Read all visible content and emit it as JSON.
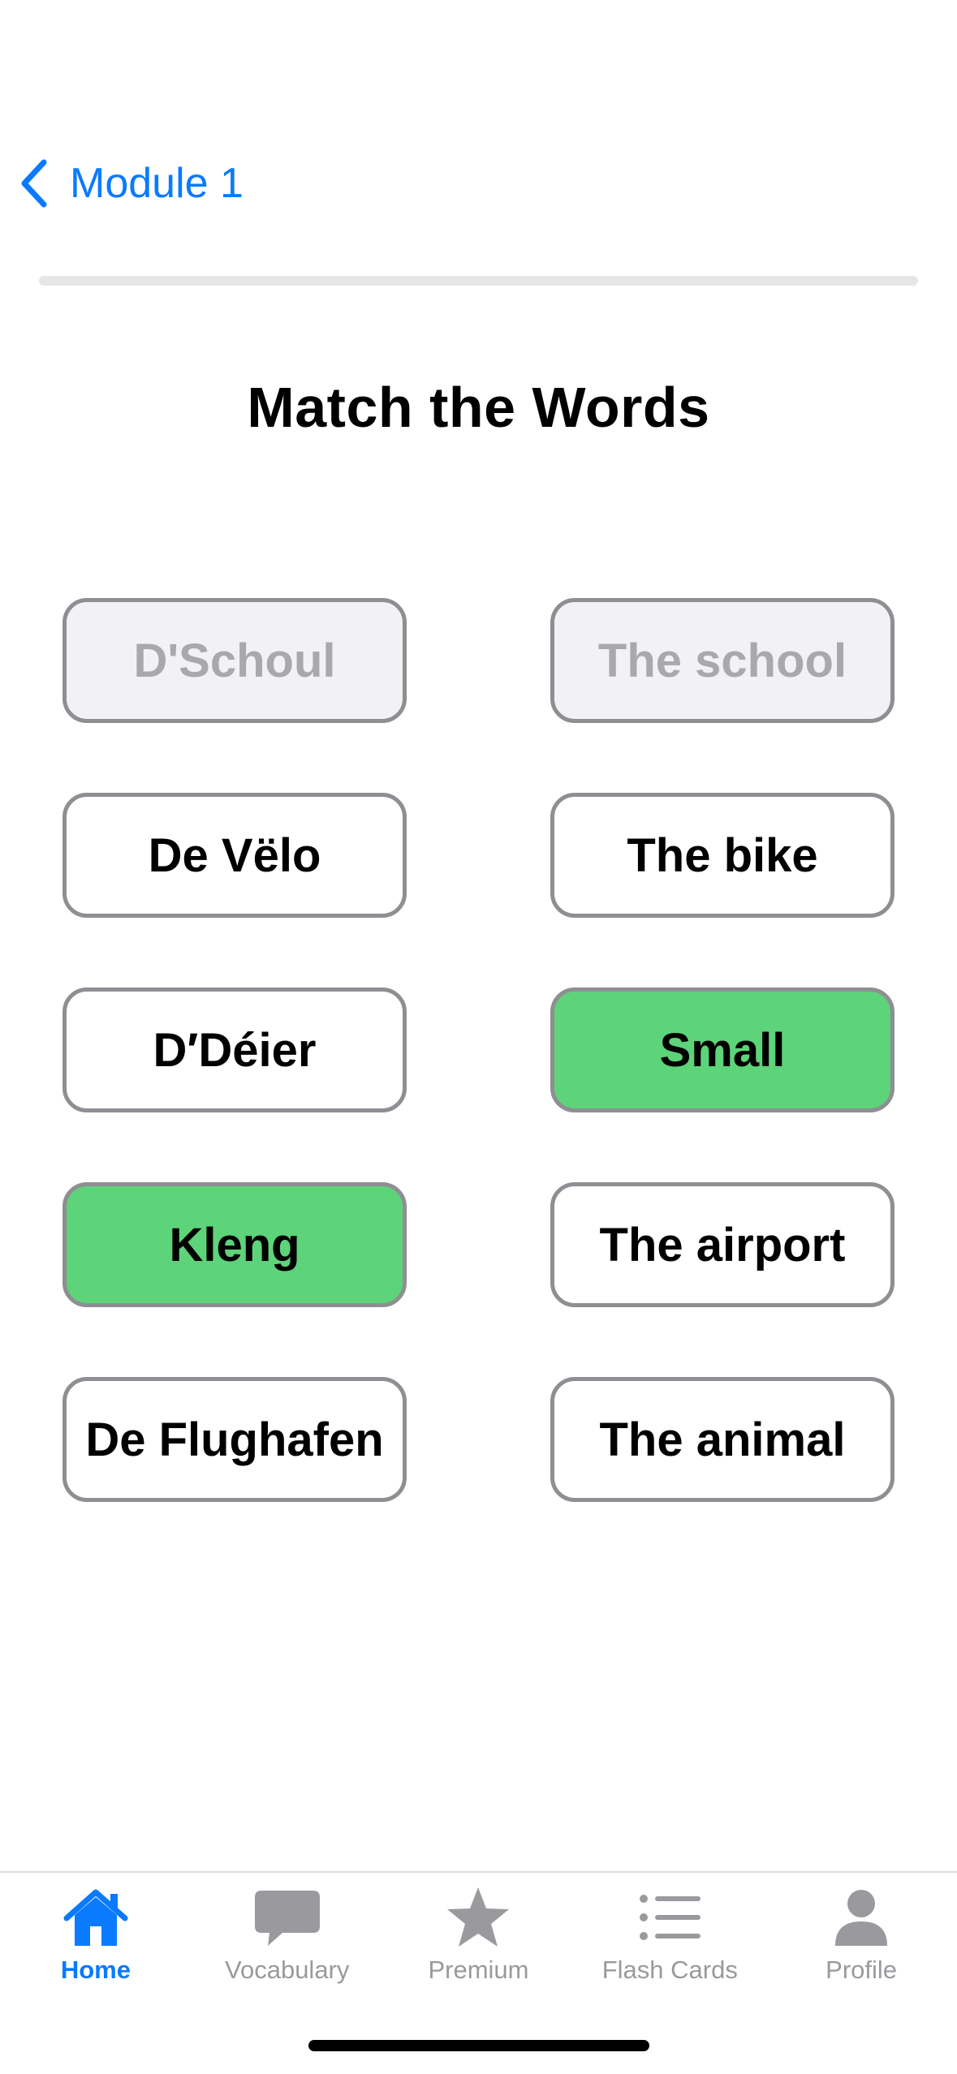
{
  "nav": {
    "back_label": "Module 1"
  },
  "progress": {
    "fraction": 0.0
  },
  "title": "Match the Words",
  "pairs_grid": {
    "left": [
      {
        "text": "D'Schoul",
        "state": "matched"
      },
      {
        "text": "De Vëlo",
        "state": "default"
      },
      {
        "text": "D′Déier",
        "state": "default"
      },
      {
        "text": "Kleng",
        "state": "selected"
      },
      {
        "text": "De Flughafen",
        "state": "default"
      }
    ],
    "right": [
      {
        "text": "The school",
        "state": "matched"
      },
      {
        "text": "The bike",
        "state": "default"
      },
      {
        "text": "Small",
        "state": "selected"
      },
      {
        "text": "The airport",
        "state": "default"
      },
      {
        "text": "The animal",
        "state": "default"
      }
    ]
  },
  "tabbar": {
    "items": [
      {
        "label": "Home",
        "icon": "house-icon",
        "active": true
      },
      {
        "label": "Vocabulary",
        "icon": "speech-bubble-icon",
        "active": false
      },
      {
        "label": "Premium",
        "icon": "star-icon",
        "active": false
      },
      {
        "label": "Flash Cards",
        "icon": "list-icon",
        "active": false
      },
      {
        "label": "Profile",
        "icon": "person-icon",
        "active": false
      }
    ]
  },
  "colors": {
    "accent": "#0a7aff",
    "selected_green": "#5dd37a",
    "matched_bg": "#f2f2f5",
    "matched_text": "#a8a8ad",
    "border_gray": "#8e8e93",
    "inactive_tab": "#9a9a9e"
  }
}
